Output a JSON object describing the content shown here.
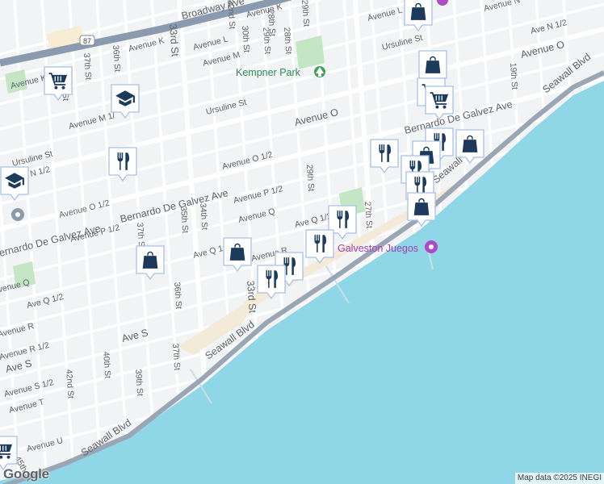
{
  "map": {
    "colors": {
      "land": "#f1f3f4",
      "water": "#8fd6e6",
      "park": "#c4e6c4",
      "beach": "#f3ead8",
      "highway": "#8a9bb0",
      "road": "#ffffff",
      "pin_glyph": "#1b3a5c"
    },
    "labels": {
      "broadway": "Broadway Ave",
      "hwy87": "87",
      "ave_k_top": "Avenue K",
      "ave_k_left": "Avenue K",
      "ave_k_1_2": "Avenue K 1/2",
      "ave_l": "Avenue L",
      "ave_m": "Avenue M",
      "ave_m_left": "Avenue M 1/",
      "ave_n": "Avenue N",
      "ave_n_right": "Ave N 1/2",
      "ave_n_1_2_left": "Ave N 1/2",
      "ave_o": "Avenue O",
      "ave_o_right": "Avenue O",
      "ave_o_1_2": "Avenue O 1/2",
      "ave_o_1_2_left": "Avenue O 1/2",
      "ave_p_1_2": "Avenue P 1/2",
      "ave_p_1_2_left": "Avenue P 1/2",
      "ave_q": "Avenue Q",
      "ave_q_left": "Avenue Q",
      "ave_q_1_2": "Ave Q 1/2",
      "ave_q_1_2_b": "Ave Q 1/2",
      "ave_q_1_2_c": "Ave Q 1/2",
      "ave_r": "Avenue R",
      "ave_r_left": "Avenue R",
      "ave_r_1_2": "Avenue R 1/2",
      "ave_s": "Ave S",
      "ave_s_left": "Ave S",
      "ave_s_1_2": "Avenue S 1/2",
      "ave_t": "Avenue T",
      "ave_u": "Avenue U",
      "ursuline_right": "Ursuline St",
      "ursuline_mid": "Ursuline St",
      "ursuline_left": "Ursuline St",
      "galvez": "Bernardo De Galvez Ave",
      "galvez_left": "Bernardo De Galvez Ave",
      "galvez_right": "Bernardo De Galvez Ave",
      "st_19": "19th St",
      "st_27": "27th St",
      "st_28": "28th St",
      "st_29": "29th St",
      "st_29_b": "29th St",
      "st_30": "30th St",
      "st_32": "32nd St",
      "st_33": "33rd St",
      "st_33_b": "33rd St",
      "st_34": "34th St",
      "st_35": "35th St",
      "st_36": "36th St",
      "st_36_b": "36th St",
      "st_37": "37th St",
      "st_37_b": "37th St",
      "st_37_c": "37th St",
      "st_38": "38th St",
      "st_39": "39th St",
      "st_40": "40th St",
      "st_42": "42nd St",
      "st_45": "45th St",
      "seawall": "Seawall Blvd",
      "seawall_right": "Seawall Blvd",
      "seawall_left": "Seawall Blvd",
      "seawall_mid": "Seawall",
      "kempner_park": "Kempner Park",
      "galveston_juegos": "Galveston Juegos"
    },
    "google_logo": "Google",
    "attribution": "Map data ©2025 INEGI"
  }
}
